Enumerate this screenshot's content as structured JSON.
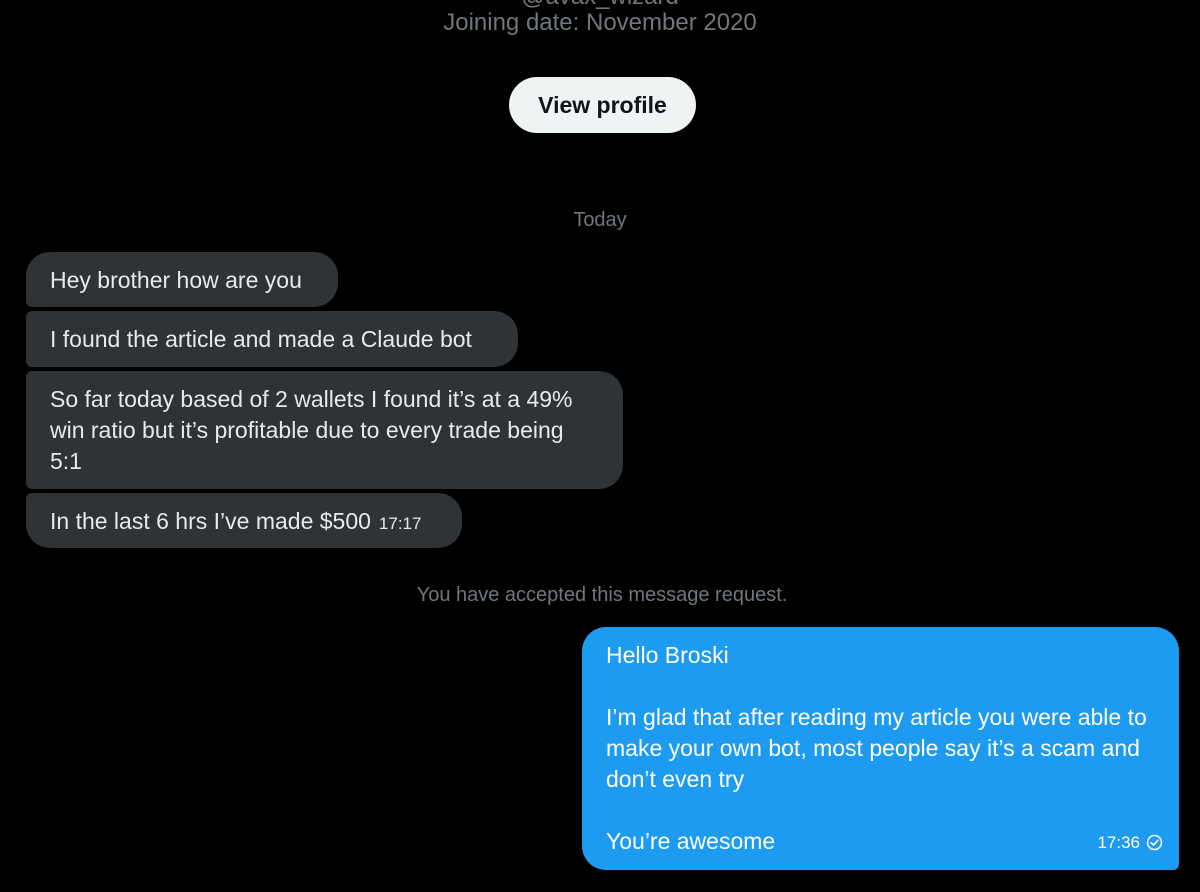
{
  "profile": {
    "handle": "@avax_wizard",
    "joining_date": "Joining date: November 2020",
    "view_profile_label": "View profile"
  },
  "conversation": {
    "day_separator": "Today",
    "incoming_messages": [
      {
        "text": "Hey brother how are you"
      },
      {
        "text": "I found the article and made a Claude bot"
      },
      {
        "text": "So far today based of 2 wallets I found it’s at a 49% win ratio but it’s profitable due to every trade being 5:1"
      },
      {
        "text": "In the last 6 hrs I’ve made $500",
        "time": "17:17"
      }
    ],
    "system_note": "You have accepted this message request.",
    "outgoing_message": {
      "line1": "Hello Broski",
      "line2": "I’m glad that after reading my article you were able to make your own bot, most people say it’s a scam and don’t even try",
      "line3": "You’re awesome",
      "time": "17:36",
      "status_icon": "check-circle-icon"
    }
  },
  "colors": {
    "background": "#000000",
    "incoming_bubble": "#2f3336",
    "outgoing_bubble": "#1d9bf0",
    "muted_text": "#71767b",
    "button_bg": "#eff3f4"
  }
}
